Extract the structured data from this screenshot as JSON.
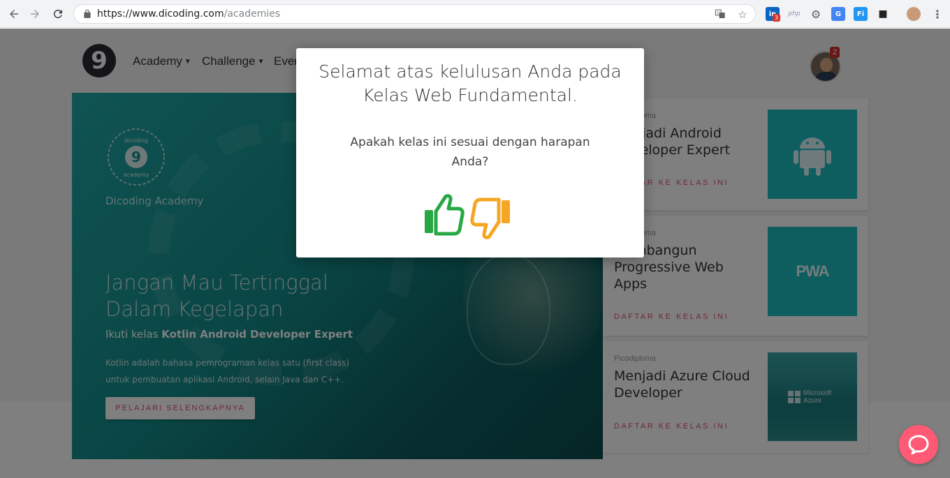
{
  "browser": {
    "url_host": "https://www.dicoding.com",
    "url_path": "/academies",
    "extension_badge": "3"
  },
  "site": {
    "logo_text": "9",
    "nav": [
      "Academy",
      "Challenge",
      "Even"
    ],
    "notification_count": "2"
  },
  "hero": {
    "brand": "Dicoding Academy",
    "badge_top": "dicoding",
    "badge_bottom": "academy",
    "title": "Jangan Mau Tertinggal Dalam Kegelapan",
    "subtitle_prefix": "Ikuti kelas ",
    "subtitle_bold": "Kotlin Android Developer Expert",
    "description": "Kotlin adalah bahasa pemrograman kelas satu (first class) untuk pembuatan aplikasi Android, selain Java dan C++.",
    "button": "PELAJARI SELENGKAPNYA"
  },
  "cards": [
    {
      "category": "Picodiploma",
      "title": "Menjadi Android Developer Expert",
      "cta": "DAFTAR KE KELAS INI",
      "thumb": "android-icon"
    },
    {
      "category": "Picodiploma",
      "title": "Membangun Progressive Web Apps",
      "cta": "DAFTAR KE KELAS INI",
      "thumb_text": "PWA"
    },
    {
      "category": "Picodiploma",
      "title": "Menjadi Azure Cloud Developer",
      "cta": "DAFTAR KE KELAS INI",
      "thumb_text": "Microsoft Azure"
    }
  ],
  "modal": {
    "title": "Selamat atas kelulusan Anda pada Kelas Web Fundamental.",
    "question": "Apakah kelas ini sesuai dengan harapan Anda?",
    "like_color": "#27a844",
    "dislike_color": "#f5a623"
  },
  "colors": {
    "accent": "#e0506a",
    "teal": "#1cbcc0",
    "chat": "#ff5a75"
  }
}
